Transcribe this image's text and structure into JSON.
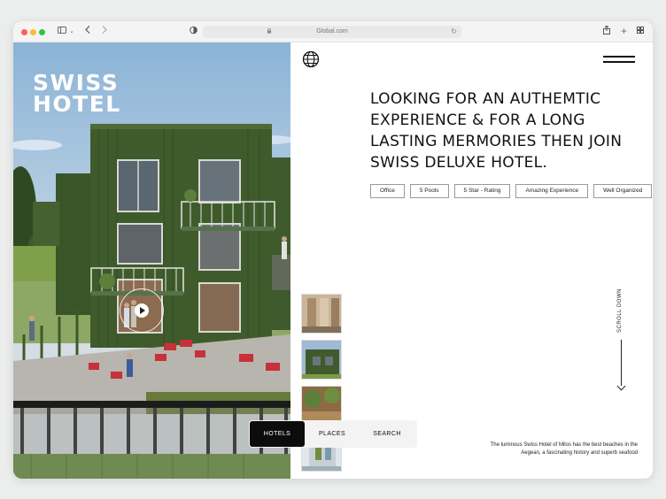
{
  "browser": {
    "url": "Global.com",
    "icons": [
      "sidebar-icon",
      "chevron-down-icon",
      "back-icon",
      "forward-icon",
      "shield-icon",
      "lock-icon",
      "reload-icon",
      "share-icon",
      "new-tab-icon",
      "tab-overview-icon"
    ]
  },
  "hero": {
    "title_line1": "SWISS",
    "title_line2": "HOTEL"
  },
  "main": {
    "headline": "LOOKING FOR AN AUTHEMTIC EXPERIENCE & FOR A LONG LASTING MERMORIES THEN JOIN SWISS DELUXE HOTEL.",
    "tags": [
      "Office",
      "5 Pools",
      "5 Star - Rating",
      "Amazing Experience",
      "Well Organized"
    ],
    "scroll_label": "SCROLL DOWN",
    "description": "The luminous Swiss Hotel of Milos has the best beaches in the Aegean, a fascinating history and superb seafood"
  },
  "nav": {
    "hotels": "HOTELS",
    "places": "PLACES",
    "search": "SEARCH"
  },
  "colors": {
    "accent": "#0c0c0c",
    "facade": "#3f5b2c",
    "background": "#ffffff"
  }
}
